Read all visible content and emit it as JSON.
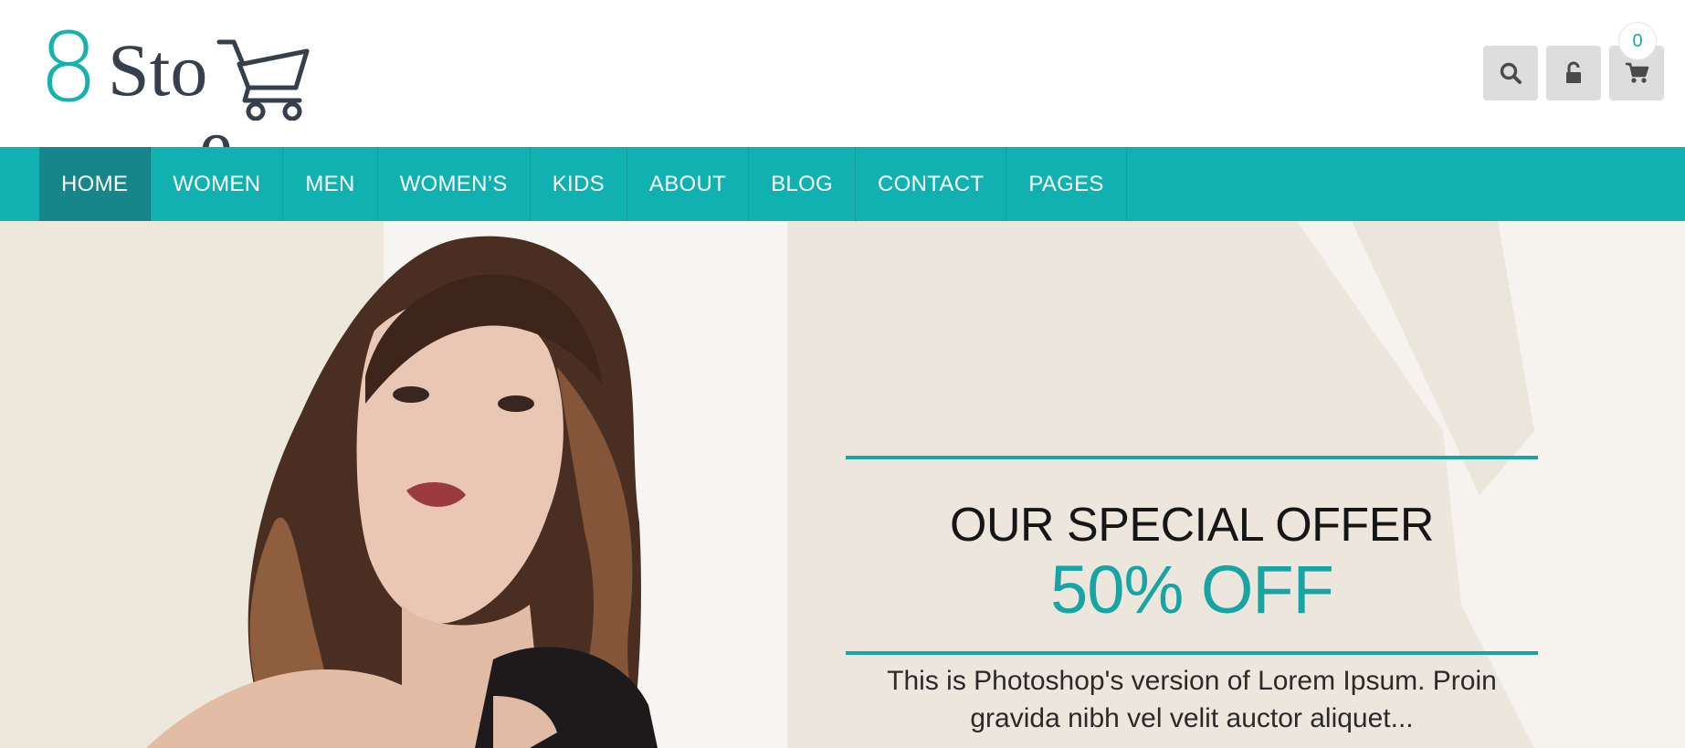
{
  "brand": {
    "logo_digit": "8",
    "logo_word_start": "Sto",
    "logo_word_end": "e",
    "accent_color": "#10b1b0",
    "dark_text_color": "#36404c"
  },
  "header": {
    "actions": [
      {
        "icon": "search-icon"
      },
      {
        "icon": "lock-icon"
      },
      {
        "icon": "shopping-cart-icon"
      }
    ],
    "cart_count": "0"
  },
  "nav": {
    "items": [
      {
        "label": "HOME",
        "active": true
      },
      {
        "label": "WOMEN",
        "active": false
      },
      {
        "label": "MEN",
        "active": false
      },
      {
        "label": "WOMEN’S",
        "active": false
      },
      {
        "label": "KIDS",
        "active": false
      },
      {
        "label": "ABOUT",
        "active": false
      },
      {
        "label": "BLOG",
        "active": false
      },
      {
        "label": "CONTACT",
        "active": false
      },
      {
        "label": "PAGES",
        "active": false
      }
    ],
    "active_color": "#16868a"
  },
  "hero": {
    "title": "OUR SPECIAL OFFER",
    "discount": "50% OFF",
    "description": "This is Photoshop's version of Lorem Ipsum. Proin gravida nibh vel velit auctor aliquet..."
  }
}
